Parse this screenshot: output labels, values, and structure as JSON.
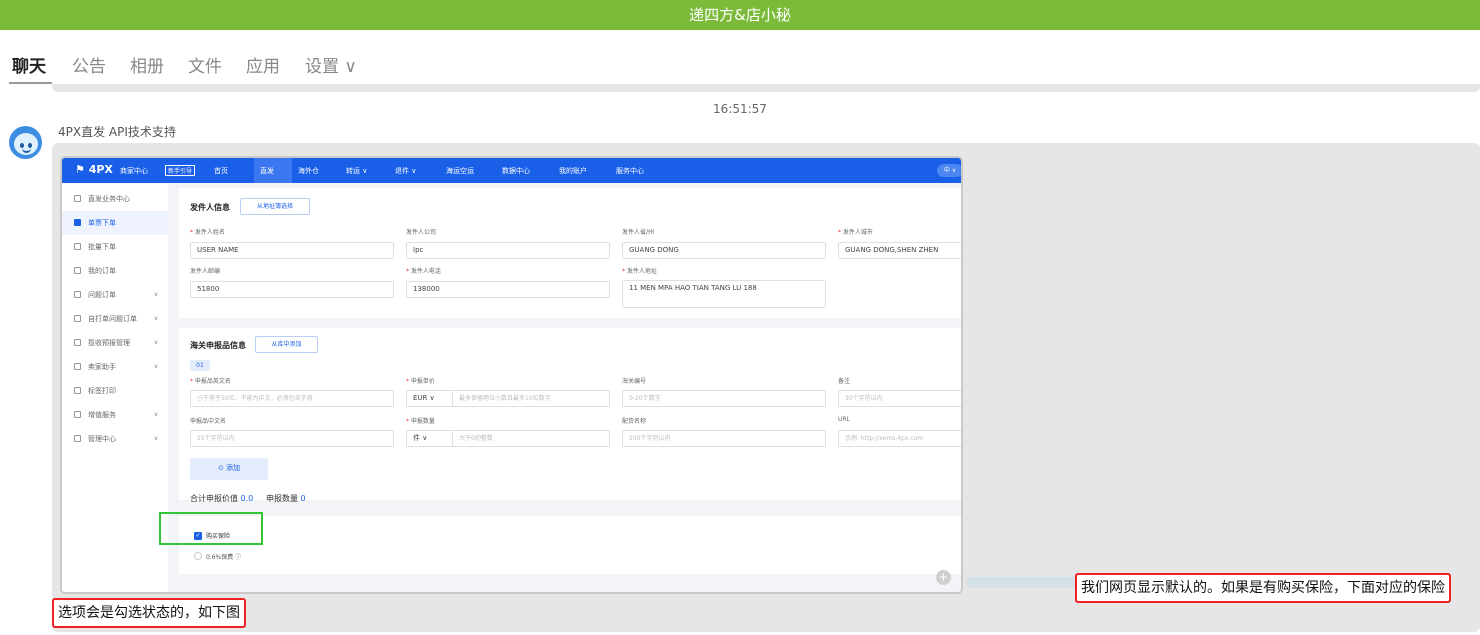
{
  "window": {
    "title": "递四方&店小秘"
  },
  "tabs": [
    {
      "label": "聊天"
    },
    {
      "label": "公告"
    },
    {
      "label": "相册"
    },
    {
      "label": "文件"
    },
    {
      "label": "应用"
    },
    {
      "label": "设置 ∨"
    }
  ],
  "chat": {
    "timestamp": "16:51:57",
    "sender": "4PX直发 API技术支持",
    "notes": {
      "right": "我们网页显示默认的。如果是有购买保险，下面对应的保险",
      "left": "选项会是勾选状态的，如下图"
    }
  },
  "screenshot": {
    "topbar": {
      "logo": "4PX",
      "sub": "商家中心",
      "badge": "新手引导",
      "nav": [
        "首页",
        "直发",
        "海外仓",
        "转运 ∨",
        "退件 ∨",
        "海运空运",
        "数据中心",
        "我的账户",
        "服务中心"
      ],
      "lang": "中 ∨"
    },
    "sidebar": [
      {
        "label": "直发业务中心",
        "chev": ""
      },
      {
        "label": "单票下单",
        "chev": ""
      },
      {
        "label": "批量下单",
        "chev": ""
      },
      {
        "label": "我的订单",
        "chev": ""
      },
      {
        "label": "问题订单",
        "chev": "∨"
      },
      {
        "label": "自打单问题订单",
        "chev": "∨"
      },
      {
        "label": "揽收预报管理",
        "chev": "∨"
      },
      {
        "label": "卖家助手",
        "chev": "∨"
      },
      {
        "label": "标签打印",
        "chev": ""
      },
      {
        "label": "增值服务",
        "chev": "∨"
      },
      {
        "label": "管理中心",
        "chev": "∨"
      }
    ],
    "sender_section": {
      "title": "发件人信息",
      "button": "从地址簿选择",
      "fields": {
        "name_label": "发件人姓名",
        "name_value": "USER NAME",
        "company_label": "发件人公司",
        "company_value": "Ipc",
        "province_label": "发件人省/州",
        "province_value": "GUANG DONG",
        "city_label": "发件人城市",
        "city_value": "GUANG DONG,SHEN ZHEN",
        "zip_label": "发件人邮编",
        "zip_value": "51800",
        "phone_label": "发件人电话",
        "phone_value": "138000",
        "address_label": "发件人地址",
        "address_value": "11 MEN MPA HAO TIAN TANG LU 188"
      }
    },
    "customs_section": {
      "title": "海关申报品信息",
      "button": "从库中添加",
      "tag": "01",
      "fields": {
        "en_name_label": "申报品英文名",
        "en_name_ph": "小于等于50位，不能为中文，必须包含字母",
        "price_label": "申报单价",
        "currency": "EUR ∨",
        "price_ph": "最多保留两位小数且最多10位数字",
        "hs_label": "海关编号",
        "hs_ph": "0-20个数字",
        "remark_label": "备注",
        "remark_ph": "30个字符以内",
        "cn_name_label": "申报品中文名",
        "cn_name_ph": "25个字符以内",
        "qty_label": "申报数量",
        "unit": "件 ∨",
        "qty_ph": "大于0的整数",
        "match_label": "配货名称",
        "match_ph": "250个字符以内",
        "url_label": "URL",
        "url_ph": "示例: http://xoms.4px.com"
      },
      "add_button": "⊙ 添加",
      "total_value_label": "合计申报价值",
      "total_value": "0.0",
      "total_qty_label": "申报数量",
      "total_qty": "0"
    },
    "insurance": {
      "checkbox_label": "购买保险",
      "option_label": "0.6%保费 ⓘ"
    }
  }
}
